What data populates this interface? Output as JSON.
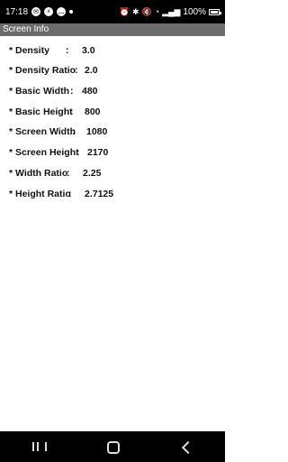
{
  "status_bar": {
    "time": "17:18",
    "battery": "100%"
  },
  "app": {
    "title": "Screen Info"
  },
  "metrics": [
    {
      "label": "* Density",
      "sep": ":",
      "value": "3.0"
    },
    {
      "label": "* Density Ratio",
      "sep": ":",
      "value": "2.0"
    },
    {
      "label": "* Basic Width",
      "sep": ":",
      "value": "480"
    },
    {
      "label": "* Basic Height",
      "sep": ":",
      "value": "800"
    },
    {
      "label": "* Screen Width",
      "sep": ":",
      "value": "1080"
    },
    {
      "label": "* Screen Height",
      "sep": ":",
      "value": "2170"
    },
    {
      "label": "* Width Ratio",
      "sep": ":",
      "value": "2.25"
    },
    {
      "label": "* Height Ratio",
      "sep": ":",
      "value": "2.7125"
    }
  ],
  "icons": {
    "status_left": [
      "message-icon",
      "messenger-icon",
      "chat-icon",
      "notification-dot-icon"
    ],
    "status_right": [
      "alarm-icon",
      "bluetooth-icon",
      "mute-icon",
      "wifi-icon",
      "signal-icon",
      "battery-icon"
    ],
    "nav": [
      "recents-icon",
      "home-icon",
      "back-icon"
    ]
  }
}
